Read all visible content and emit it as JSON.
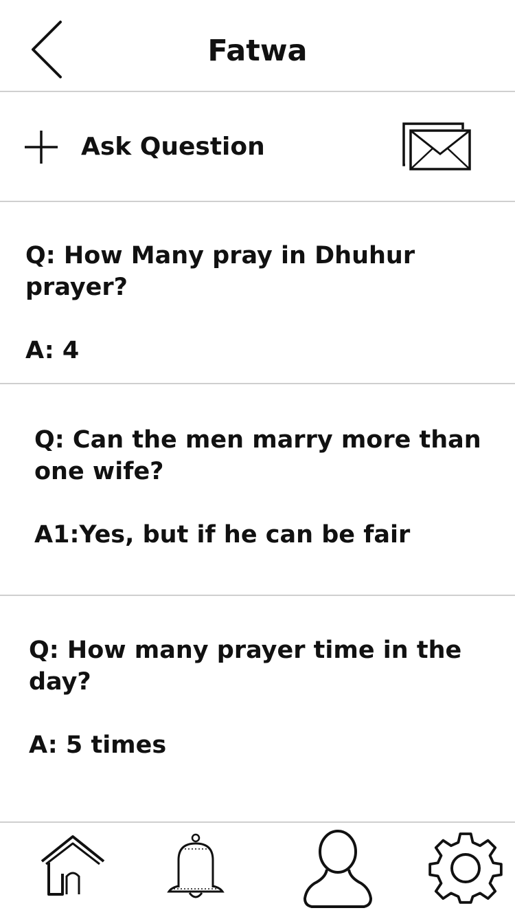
{
  "header": {
    "title": "Fatwa",
    "back_icon": "chevron-left-icon"
  },
  "ask": {
    "label": "Ask Question",
    "plus_icon": "plus-icon",
    "mail_icon": "mail-stack-icon"
  },
  "qa_items": [
    {
      "question": "Q: How Many pray in Dhuhur\nprayer?",
      "answer": "A: 4"
    },
    {
      "question": "Q: Can the men marry more than\none wife?",
      "answer": "A1:Yes, but if  he can be fair"
    },
    {
      "question": "Q: How many prayer time in the\n day?",
      "answer": "A: 5 times"
    }
  ],
  "bottom_nav": {
    "items": [
      {
        "icon": "home-icon"
      },
      {
        "icon": "bell-icon"
      },
      {
        "icon": "user-icon"
      },
      {
        "icon": "gear-icon"
      }
    ]
  },
  "colors": {
    "text": "#111111",
    "divider": "#cfcfcf",
    "background": "#ffffff"
  }
}
